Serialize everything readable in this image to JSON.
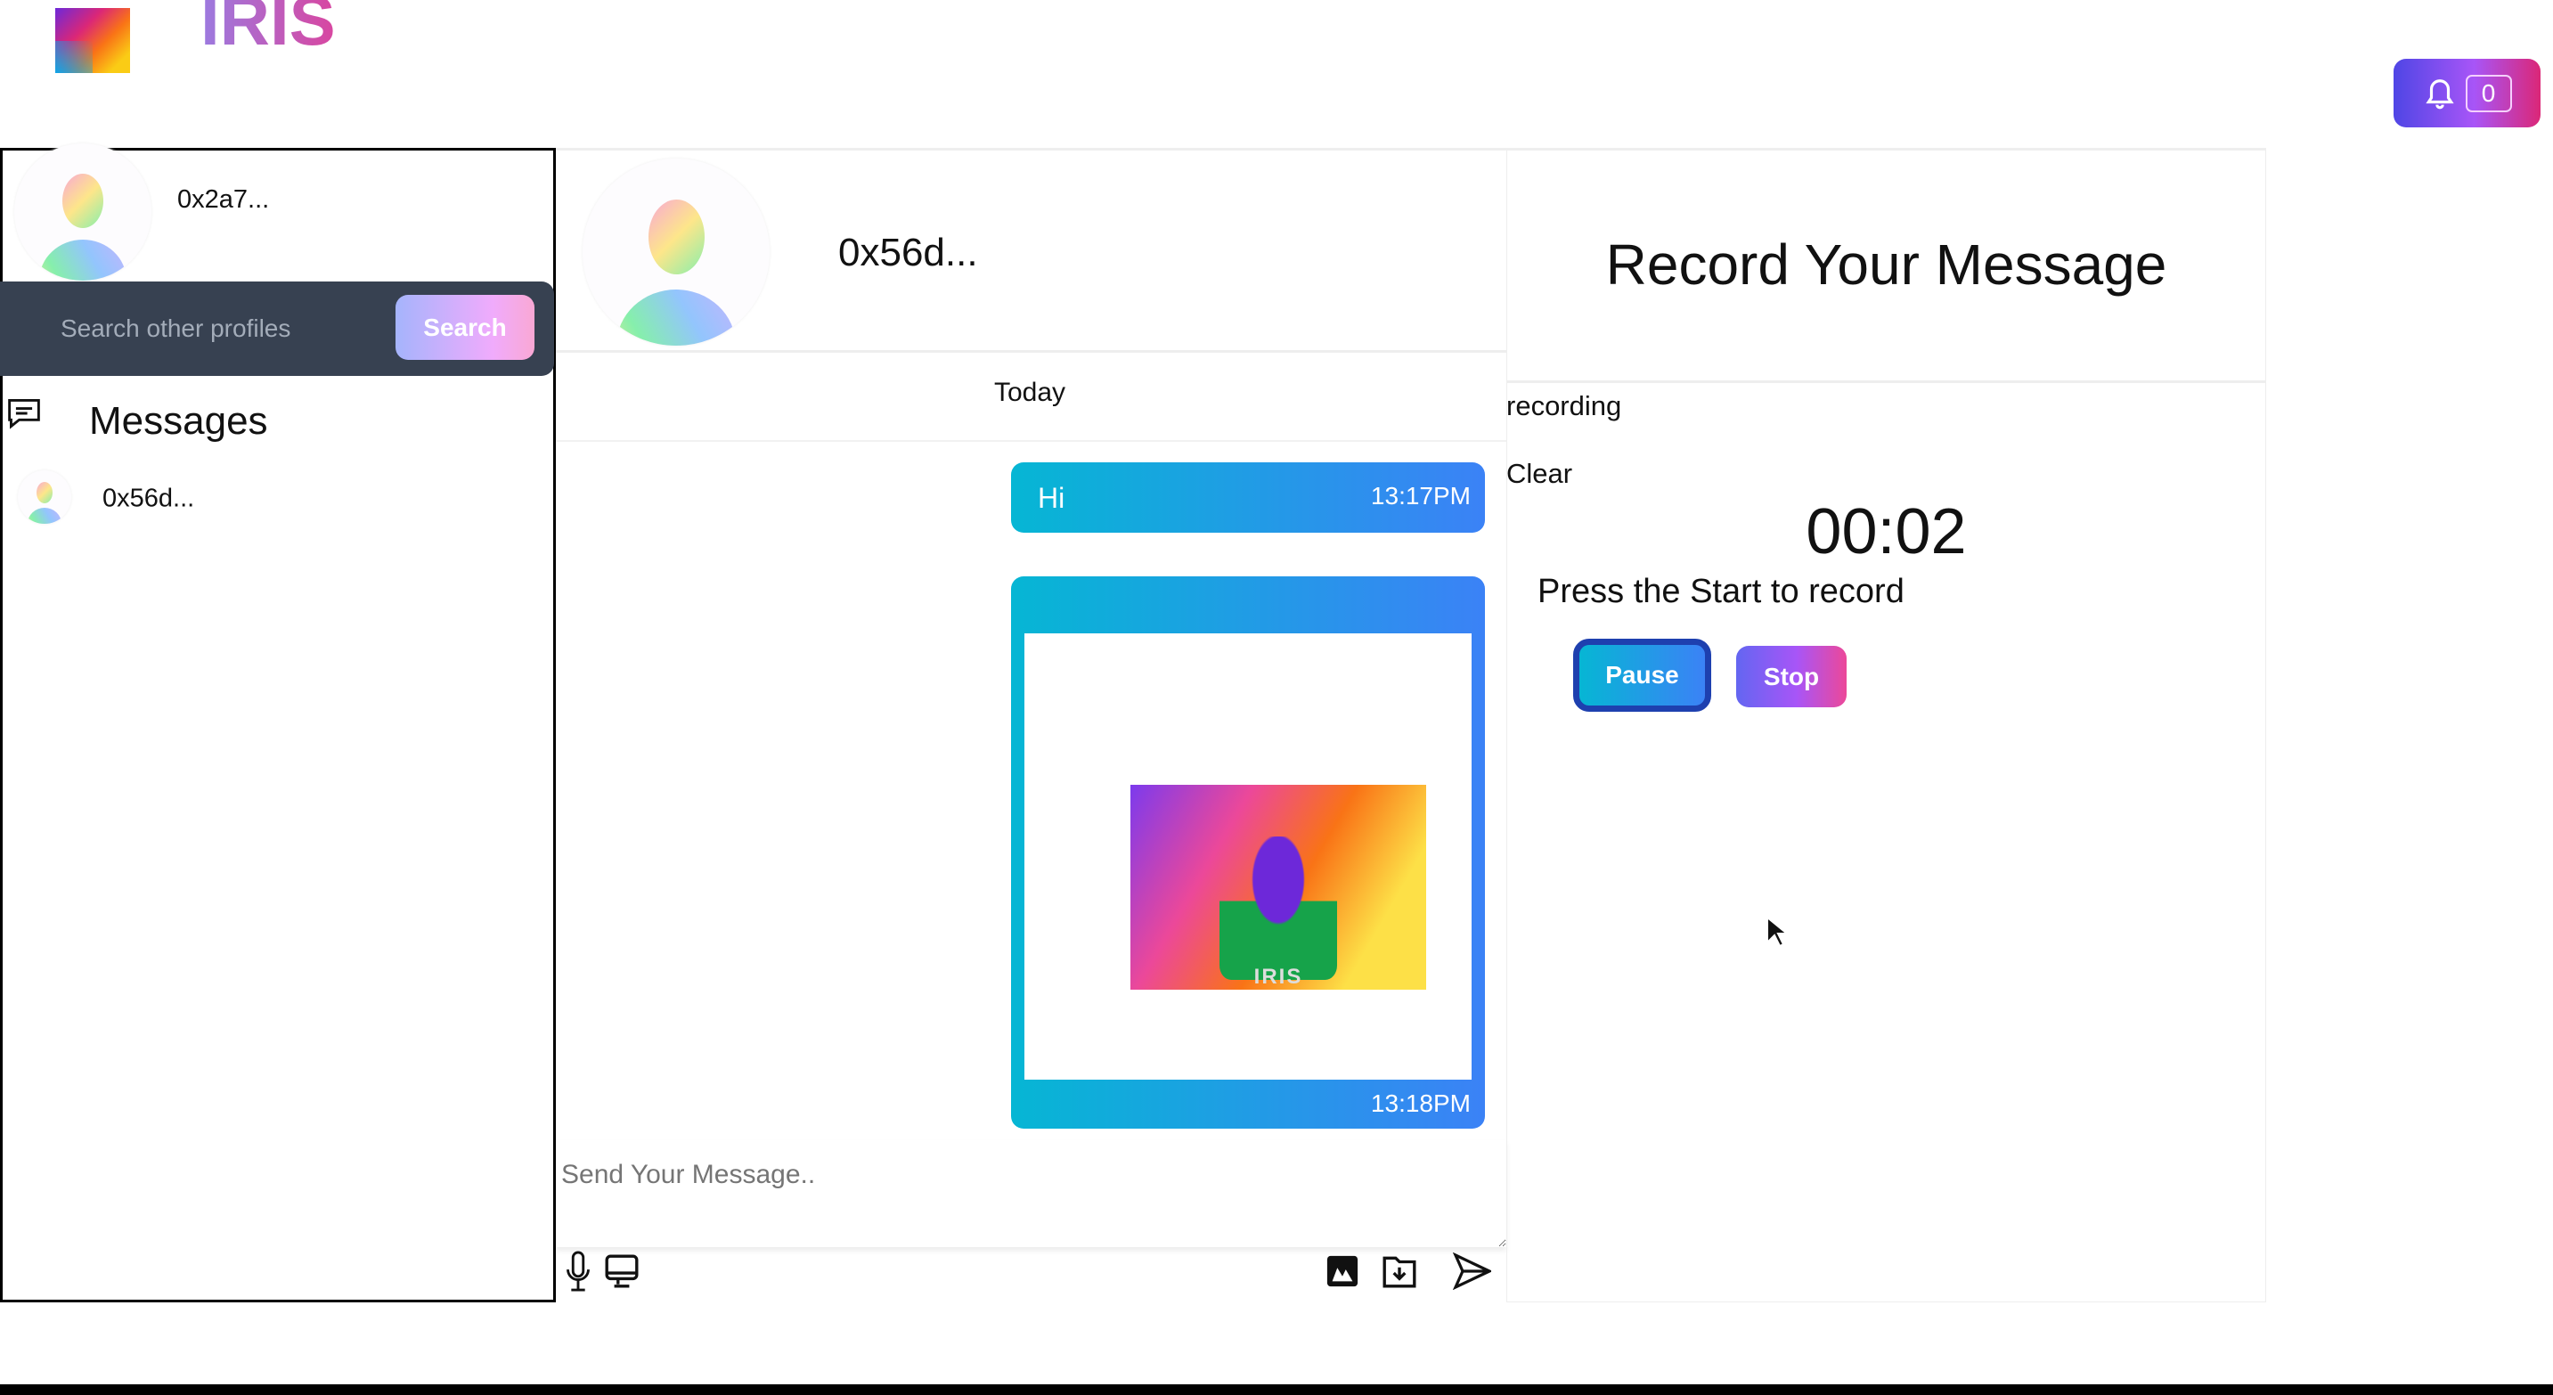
{
  "header": {
    "brand": "IRIS",
    "notifications": {
      "count": "0",
      "icon": "bell-icon"
    }
  },
  "sidebar": {
    "profile_name": "0x2a7...",
    "search": {
      "placeholder": "Search other profiles",
      "button": "Search"
    },
    "messages_title": "Messages",
    "conversations": [
      {
        "name": "0x56d..."
      }
    ]
  },
  "chat": {
    "contact_name": "0x56d...",
    "date_divider": "Today",
    "messages": [
      {
        "type": "text",
        "text": "Hi",
        "time": "13:17PM"
      },
      {
        "type": "image",
        "image_caption": "IRIS",
        "time": "13:18PM"
      }
    ],
    "input": {
      "placeholder": "Send Your Message..",
      "value": ""
    },
    "toolbar_icons": [
      "microphone-icon",
      "monitor-icon",
      "image-icon",
      "folder-download-icon",
      "send-icon"
    ]
  },
  "recorder": {
    "title": "Record Your Message",
    "status": "recording",
    "clear": "Clear",
    "timer": "00:02",
    "hint": "Press the Start to record",
    "pause": "Pause",
    "stop": "Stop"
  },
  "colors": {
    "bubble_start": "#06b6d4",
    "bubble_end": "#3b82f6",
    "search_bar": "#374151",
    "notif_start": "#4f46e5",
    "notif_end": "#db2777"
  }
}
